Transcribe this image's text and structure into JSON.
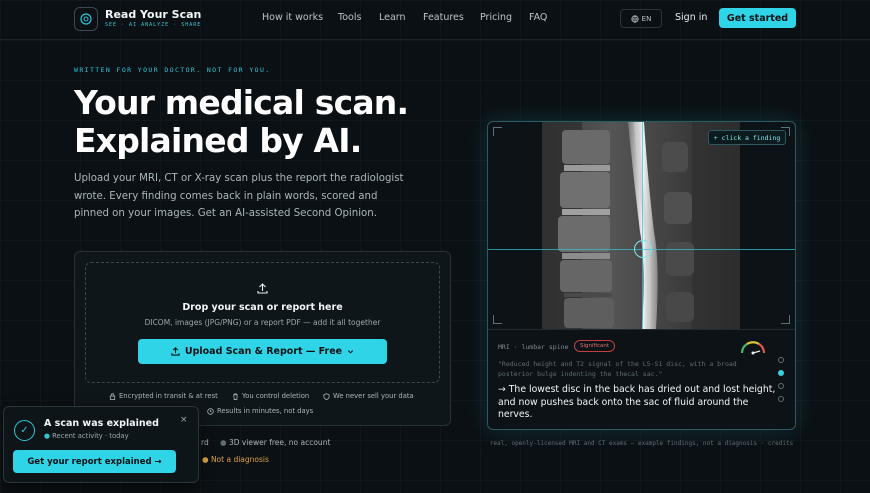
{
  "brand": {
    "name": "Read Your Scan",
    "tagline": "SEE · AI ANALYZE · SHARE"
  },
  "nav": {
    "links": [
      "How it works",
      "Tools",
      "Learn",
      "Features",
      "Pricing",
      "FAQ"
    ],
    "lang": "EN",
    "signin": "Sign in",
    "cta": "Get started"
  },
  "hero": {
    "eyebrow": "WRITTEN FOR YOUR DOCTOR. NOT FOR YOU.",
    "title_line1": "Your medical scan.",
    "title_line2": "Explained by AI.",
    "lead": "Upload your MRI, CT or X-ray scan plus the report the radiologist wrote. Every finding comes back in plain words, scored and pinned on your images. Get an AI-assisted Second Opinion."
  },
  "upload": {
    "title": "Drop your scan or report here",
    "subtitle": "DICOM, images (JPG/PNG) or a report PDF — add it all together",
    "button": "Upload Scan & Report — Free",
    "trust": [
      "Encrypted in transit & at rest",
      "You control deletion",
      "We never sell your data",
      "Results in minutes, not days"
    ]
  },
  "below": {
    "item1": "rd",
    "item2": "3D viewer free, no account",
    "warning": "Not a diagnosis"
  },
  "toast": {
    "title": "A scan was explained",
    "subtitle": "Recent activity · today",
    "close": "×",
    "button": "Get your report explained →"
  },
  "panel": {
    "click_hint": "+ click a finding",
    "meta": "MRI · lumbar spine",
    "badge": "Significant",
    "quote": "\"Reduced height and T2 signal of the L5-S1 disc, with a broad posterior bulge indenting the thecal sac.\"",
    "plain": "→ The lowest disc in the back has dried out and lost height, and now pushes back onto the sac of fluid around the nerves.",
    "caption": "real, openly-licensed MRI and CT exams — example findings, not a diagnosis · credits"
  },
  "icons": {
    "logo": "logo-scan-icon",
    "globe": "globe-icon",
    "upload": "upload-icon",
    "lock": "lock-icon",
    "trash": "trash-icon",
    "shield": "shield-icon",
    "clock": "clock-icon",
    "check": "check-icon",
    "gauge": "gauge-icon"
  },
  "colors": {
    "accent": "#2fd4e6",
    "background": "#0b1014",
    "warning": "#e0a23a",
    "danger": "#e57373"
  }
}
